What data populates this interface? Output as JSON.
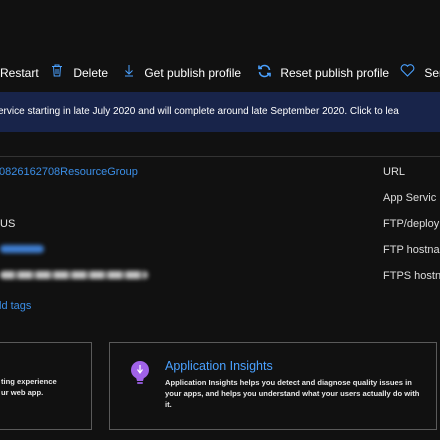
{
  "toolbar": {
    "restart": "Restart",
    "delete": "Delete",
    "get_publish_profile": "Get publish profile",
    "reset_publish_profile": "Reset publish profile",
    "send_partial": "Ser"
  },
  "banner": {
    "text": "ervice starting in late July 2020 and will complete around late September 2020. Click to lea"
  },
  "essentials": {
    "resource_group": "0826162708ResourceGroup",
    "location_partial": "US",
    "add_tags": "ld tags",
    "right_labels": [
      "URL",
      "App Servic",
      "FTP/deploy",
      "FTP hostna",
      "FTPS hostn"
    ]
  },
  "cards": {
    "left": {
      "desc": "ting experience\nur web app."
    },
    "right": {
      "title": "Application Insights",
      "desc": "Application Insights helps you detect and diagnose quality issues in your apps, and helps you understand what your users actually do with it."
    }
  },
  "colors": {
    "accent": "#3b8ee6",
    "banner_bg": "#18244a",
    "insights_purple": "#a062e8"
  }
}
